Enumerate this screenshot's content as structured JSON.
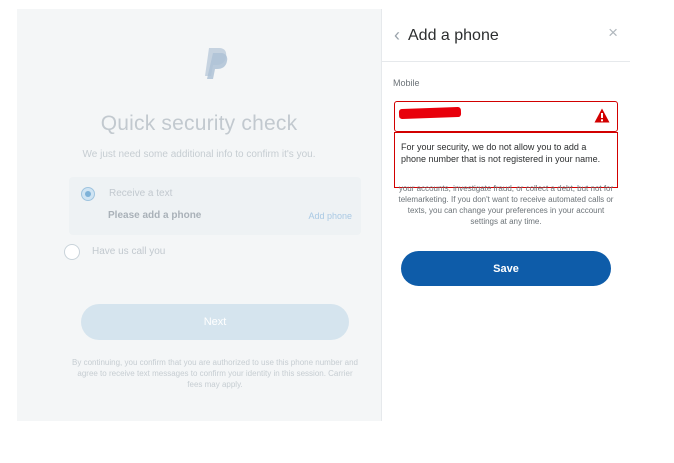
{
  "left": {
    "title": "Quick security check",
    "subtitle": "We just need some additional info to confirm it's you.",
    "option_text": "Receive a text",
    "option_text_sub": "Please add a phone",
    "option_text_link": "Add phone",
    "option_call": "Have us call you",
    "next_label": "Next",
    "footer": "By continuing, you confirm that you are authorized to use this phone number and agree to receive text messages to confirm your identity in this session. Carrier fees may apply."
  },
  "right": {
    "back_icon": "‹",
    "title": "Add a phone",
    "close_icon": "×",
    "mobile_label": "Mobile",
    "error_text": "For your security, we do not allow you to add a phone number that is not registered in your name.",
    "disclaimer": "your accounts, investigate fraud, or collect a debt, but not for telemarketing. If you don't want to receive automated calls or texts, you can change your preferences in your account settings at any time.",
    "save_label": "Save"
  },
  "icons": {
    "logo": "paypal-logo",
    "warning": "warning-icon"
  },
  "colors": {
    "primary": "#0e5ca9",
    "error": "#d20000"
  }
}
